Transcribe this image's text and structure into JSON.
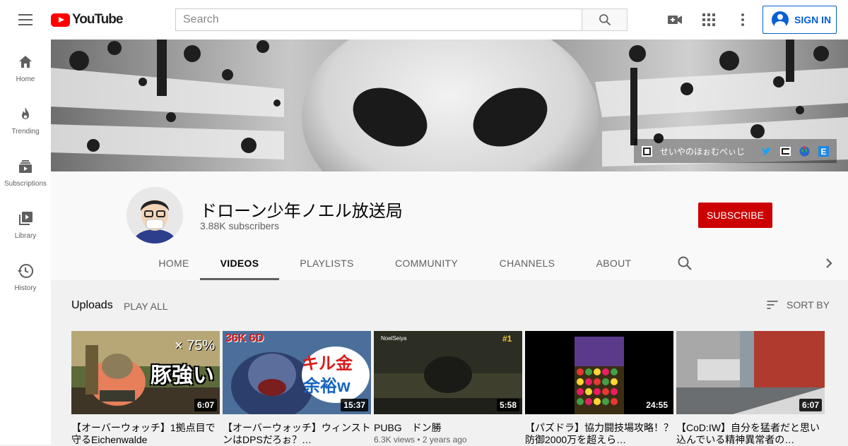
{
  "header": {
    "logo_text": "YouTube",
    "search_placeholder": "Search",
    "signin_label": "SIGN IN"
  },
  "sidebar": {
    "items": [
      {
        "label": "Home",
        "icon": "home-icon"
      },
      {
        "label": "Trending",
        "icon": "flame-icon"
      },
      {
        "label": "Subscriptions",
        "icon": "subscriptions-icon"
      },
      {
        "label": "Library",
        "icon": "library-icon"
      },
      {
        "label": "History",
        "icon": "history-icon"
      }
    ]
  },
  "banner": {
    "link_label": "せいやのほぉむぺぃじ",
    "link_icons": [
      "twitter-icon",
      "niconico-icon",
      "earth-icon",
      "e-icon"
    ],
    "link_colors": {
      "twitter": "#1da1f2",
      "e": "#1e88e5"
    }
  },
  "channel": {
    "name": "ドローン少年ノエル放送局",
    "subscribers": "3.88K subscribers",
    "subscribe_label": "SUBSCRIBE"
  },
  "tabs": [
    {
      "label": "HOME",
      "active": false
    },
    {
      "label": "VIDEOS",
      "active": true
    },
    {
      "label": "PLAYLISTS",
      "active": false
    },
    {
      "label": "COMMUNITY",
      "active": false
    },
    {
      "label": "CHANNELS",
      "active": false
    },
    {
      "label": "ABOUT",
      "active": false
    }
  ],
  "uploads": {
    "title": "Uploads",
    "play_all": "PLAY ALL",
    "sort_by": "SORT BY"
  },
  "videos": [
    {
      "title": "【オーバーウォッチ】1拠点目で守るEichenwalde",
      "meta": "",
      "duration": "6:07",
      "thumb_text": "豚強い",
      "thumb_subtext": "× 75%"
    },
    {
      "title": "【オーバーウォッチ】ウィンストンはDPSだろぉ？…",
      "meta": "",
      "duration": "15:37",
      "thumb_text": "キル金",
      "thumb_subtext": "余裕w",
      "thumb_corner": "36K 6D"
    },
    {
      "title": "PUBG　ドン勝",
      "meta": "6.3K views • 2 years ago",
      "duration": "5:58",
      "thumb_text": "NoelSeiya",
      "thumb_subtext": "#1"
    },
    {
      "title": "【パズドラ】協力闘技場攻略！？防御2000万を超えら…",
      "meta": "",
      "duration": "24:55"
    },
    {
      "title": "【CoD:IW】自分を猛者だと思い込んでいる精神異常者の…",
      "meta": "",
      "duration": "6:07"
    }
  ],
  "colors": {
    "brand_red": "#ff0000",
    "subscribe_red": "#cc0000",
    "signin_blue": "#065fd4"
  }
}
